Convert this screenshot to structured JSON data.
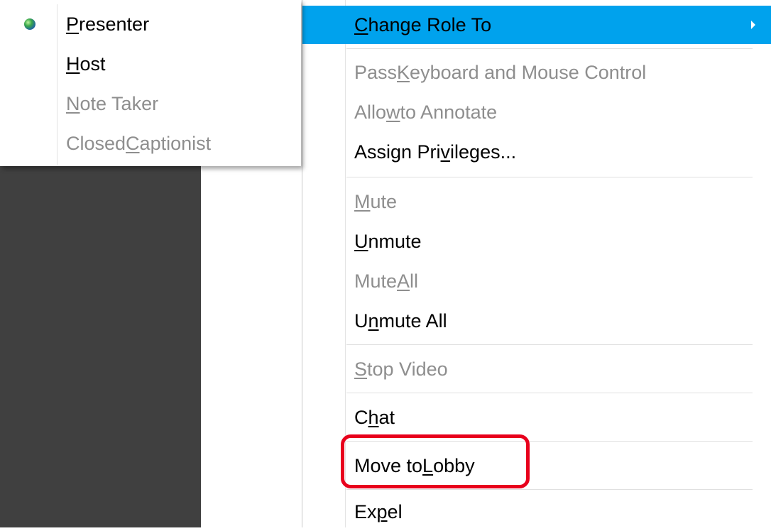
{
  "submenu": {
    "items": [
      {
        "pre": "",
        "u": "P",
        "post": "resenter",
        "checked": true
      },
      {
        "pre": "",
        "u": "H",
        "post": "ost"
      },
      {
        "pre": "",
        "u": "N",
        "post": "ote Taker"
      },
      {
        "pre": "Closed ",
        "u": "C",
        "post": "aptionist"
      }
    ]
  },
  "menu": {
    "items": [
      {
        "pre": "",
        "u": "C",
        "post": "hange Role To"
      },
      {
        "pre": "Pass ",
        "u": "K",
        "post": "eyboard and Mouse Control"
      },
      {
        "pre": "Allo",
        "u": "w",
        "post": " to Annotate"
      },
      {
        "pre": "Assign Pri",
        "u": "v",
        "post": "ileges..."
      },
      {
        "pre": "",
        "u": "M",
        "post": "ute"
      },
      {
        "pre": "",
        "u": "U",
        "post": "nmute"
      },
      {
        "pre": "Mute ",
        "u": "A",
        "post": "ll"
      },
      {
        "pre": "U",
        "u": "n",
        "post": "mute All"
      },
      {
        "pre": "",
        "u": "S",
        "post": "top Video"
      },
      {
        "pre": "C",
        "u": "h",
        "post": "at"
      },
      {
        "pre": "Move to ",
        "u": "L",
        "post": "obby"
      },
      {
        "pre": "Ex",
        "u": "p",
        "post": "el"
      }
    ]
  },
  "colors": {
    "highlight": "#00a2ed",
    "callout": "#e8001c",
    "disabled_text": "#8e8e8e",
    "background_panel": "#404040"
  }
}
